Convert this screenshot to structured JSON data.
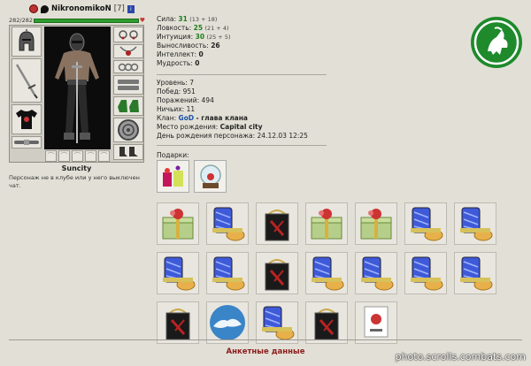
{
  "character": {
    "name": "NikronomikoN",
    "level": "[7]",
    "info_icon": "i",
    "hp": "282/282",
    "hp_fraction": 1.0,
    "city": "Suncity",
    "status_line": "Персонаж не в клубе или у него выключен чат."
  },
  "stats": {
    "strength": {
      "label": "Сила:",
      "value": "31",
      "extra": "(13 + 18)"
    },
    "agility": {
      "label": "Ловкость:",
      "value": "25",
      "extra": "(21 + 4)"
    },
    "intuition": {
      "label": "Интуиция:",
      "value": "30",
      "extra": "(25 + 5)"
    },
    "endurance": {
      "label": "Выносливость:",
      "value": "26"
    },
    "intellect": {
      "label": "Интеллект:",
      "value": "0"
    },
    "wisdom": {
      "label": "Мудрость:",
      "value": "0"
    }
  },
  "info": {
    "level": {
      "label": "Уровень:",
      "value": "7"
    },
    "wins": {
      "label": "Побед:",
      "value": "951"
    },
    "losses": {
      "label": "Поражений:",
      "value": "494"
    },
    "draws": {
      "label": "Ничьих:",
      "value": "11"
    },
    "clan": {
      "label": "Клан:",
      "name": "GoD",
      "role": "- глава клана"
    },
    "birthplace": {
      "label": "Место рождения:",
      "value": "Capital city"
    },
    "birthday": {
      "label": "День рождения персонажа:",
      "value": "24.12.03 12:25"
    }
  },
  "gifts": {
    "label": "Подарки:"
  },
  "inventory_rows": [
    [
      "gift-box",
      "can-bundle",
      "black-bag",
      "gift-box",
      "gift-box",
      "can-bundle",
      "can-bundle"
    ],
    [
      "can-bundle",
      "can-bundle",
      "black-bag",
      "can-bundle",
      "can-bundle",
      "can-bundle",
      "can-bundle"
    ],
    [
      "black-bag",
      "snow-globe",
      "can-bundle",
      "black-bag",
      "postcard"
    ]
  ],
  "colors": {
    "hp_bar": "#2f9e2f",
    "logo": "#1f8a2b",
    "accent_title": "#8c1c1c",
    "clan_link": "#1a4fa8"
  },
  "footer": {
    "title": "Анкетные данные"
  },
  "watermark": "photo.scrolls.combats.com"
}
